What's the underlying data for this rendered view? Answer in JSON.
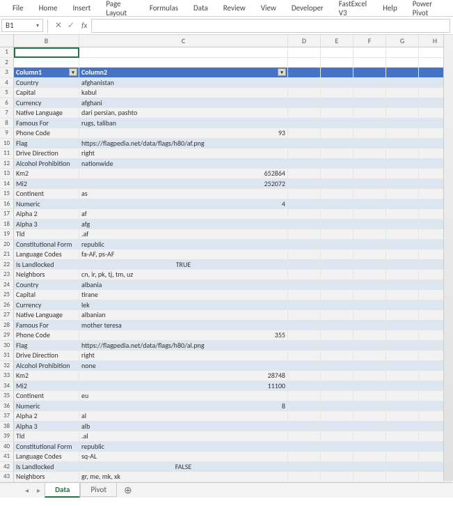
{
  "ribbon": {
    "tabs": [
      "File",
      "Home",
      "Insert",
      "Page Layout",
      "Formulas",
      "Data",
      "Review",
      "View",
      "Developer",
      "FastExcel V3",
      "Help",
      "Power Pivot"
    ]
  },
  "nameBox": {
    "value": "B1"
  },
  "formulaBar": {
    "value": ""
  },
  "columns": [
    "B",
    "C",
    "D",
    "E",
    "F",
    "G",
    "H"
  ],
  "headerRow": {
    "col1": "Column1",
    "col2": "Column2"
  },
  "rows": [
    {
      "n": 1,
      "b": "",
      "c": "",
      "band": ""
    },
    {
      "n": 2,
      "b": "",
      "c": "",
      "band": ""
    },
    {
      "n": 3,
      "header": true
    },
    {
      "n": 4,
      "b": "Country",
      "c": "afghanistan",
      "band": "1"
    },
    {
      "n": 5,
      "b": "Capital",
      "c": "kabul",
      "band": "0"
    },
    {
      "n": 6,
      "b": "Currency",
      "c": "afghani",
      "band": "1"
    },
    {
      "n": 7,
      "b": "Native Language",
      "c": "dari persian, pashto",
      "band": "0"
    },
    {
      "n": 8,
      "b": "Famous For",
      "c": "rugs, taliban",
      "band": "1"
    },
    {
      "n": 9,
      "b": "Phone Code",
      "c": "93",
      "align": "r",
      "band": "0"
    },
    {
      "n": 10,
      "b": "Flag",
      "c": "https://flagpedia.net/data/flags/h80/af.png",
      "band": "1"
    },
    {
      "n": 11,
      "b": "Drive Direction",
      "c": "right",
      "band": "0"
    },
    {
      "n": 12,
      "b": "Alcohol Prohibition",
      "c": "nationwide",
      "band": "1"
    },
    {
      "n": 13,
      "b": "Km2",
      "c": "652864",
      "align": "r",
      "band": "0"
    },
    {
      "n": 14,
      "b": "Mi2",
      "c": "252072",
      "align": "r",
      "band": "1"
    },
    {
      "n": 15,
      "b": "Continent",
      "c": "as",
      "band": "0"
    },
    {
      "n": 16,
      "b": "Numeric",
      "c": "4",
      "align": "r",
      "band": "1"
    },
    {
      "n": 17,
      "b": "Alpha 2",
      "c": "af",
      "band": "0"
    },
    {
      "n": 18,
      "b": "Alpha 3",
      "c": "afg",
      "band": "1"
    },
    {
      "n": 19,
      "b": "Tld",
      "c": ".af",
      "band": "0"
    },
    {
      "n": 20,
      "b": "Constitutional Form",
      "c": "republic",
      "band": "1"
    },
    {
      "n": 21,
      "b": "Language Codes",
      "c": "fa-AF, ps-AF",
      "band": "0"
    },
    {
      "n": 22,
      "b": "Is Landlocked",
      "c": "TRUE",
      "align": "c",
      "band": "1"
    },
    {
      "n": 23,
      "b": "Neighbors",
      "c": "cn, ir, pk, tj, tm, uz",
      "band": "0"
    },
    {
      "n": 24,
      "b": "Country",
      "c": "albania",
      "band": "1"
    },
    {
      "n": 25,
      "b": "Capital",
      "c": "tirane",
      "band": "0"
    },
    {
      "n": 26,
      "b": "Currency",
      "c": "lek",
      "band": "1"
    },
    {
      "n": 27,
      "b": "Native Language",
      "c": "albanian",
      "band": "0"
    },
    {
      "n": 28,
      "b": "Famous For",
      "c": "mother teresa",
      "band": "1"
    },
    {
      "n": 29,
      "b": "Phone Code",
      "c": "355",
      "align": "r",
      "band": "0"
    },
    {
      "n": 30,
      "b": "Flag",
      "c": "https://flagpedia.net/data/flags/h80/al.png",
      "band": "1"
    },
    {
      "n": 31,
      "b": "Drive Direction",
      "c": "right",
      "band": "0"
    },
    {
      "n": 32,
      "b": "Alcohol Prohibition",
      "c": "none",
      "band": "1"
    },
    {
      "n": 33,
      "b": "Km2",
      "c": "28748",
      "align": "r",
      "band": "0"
    },
    {
      "n": 34,
      "b": "Mi2",
      "c": "11100",
      "align": "r",
      "band": "1"
    },
    {
      "n": 35,
      "b": "Continent",
      "c": "eu",
      "band": "0"
    },
    {
      "n": 36,
      "b": "Numeric",
      "c": "8",
      "align": "r",
      "band": "1"
    },
    {
      "n": 37,
      "b": "Alpha 2",
      "c": "al",
      "band": "0"
    },
    {
      "n": 38,
      "b": "Alpha 3",
      "c": "alb",
      "band": "1"
    },
    {
      "n": 39,
      "b": "Tld",
      "c": ".al",
      "band": "0"
    },
    {
      "n": 40,
      "b": "Constitutional Form",
      "c": "republic",
      "band": "1"
    },
    {
      "n": 41,
      "b": "Language Codes",
      "c": "sq-AL",
      "band": "0"
    },
    {
      "n": 42,
      "b": "Is Landlocked",
      "c": "FALSE",
      "align": "c",
      "band": "1"
    },
    {
      "n": 43,
      "b": "Neighbors",
      "c": "gr, me, mk, xk",
      "band": "0"
    }
  ],
  "sheetTabs": {
    "active": "Data",
    "other": "Pivot"
  }
}
